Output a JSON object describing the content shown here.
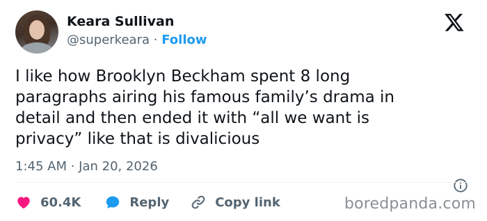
{
  "author": {
    "name": "Keara Sullivan",
    "handle": "@superkeara",
    "separator": "·",
    "follow_label": "Follow"
  },
  "tweet": {
    "lines": [
      "I like how Brooklyn Beckham spent 8 long",
      "paragraphs airing his famous family’s drama in",
      "detail and then ended it with “all we want is",
      "privacy” like that is divalicious"
    ],
    "timestamp": "1:45 AM · Jan 20, 2026"
  },
  "actions": {
    "likes": "60.4K",
    "reply_label": "Reply",
    "copy_link_label": "Copy link"
  },
  "watermark": "boredpanda.com",
  "colors": {
    "accent": "#1d9bf0",
    "like": "#f91880",
    "muted": "#536471",
    "text": "#0f1419"
  },
  "icons": [
    "x-logo-icon",
    "info-icon",
    "heart-icon",
    "reply-bubble-icon",
    "link-icon"
  ]
}
